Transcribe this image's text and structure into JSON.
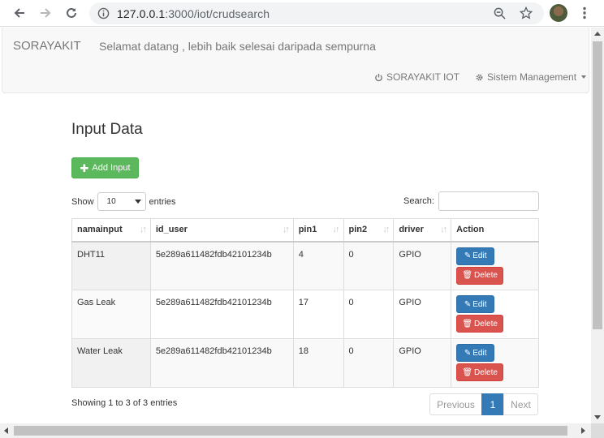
{
  "browser": {
    "url_host": "127.0.0.1",
    "url_path": ":3000/iot/crudsearch"
  },
  "navbar": {
    "brand": "SORAYAKIT",
    "welcome": "Selamat datang , lebih baik selesai daripada sempurna",
    "link_iot": "SORAYAKIT IOT",
    "link_system": "Sistem Management"
  },
  "page": {
    "title": "Input Data",
    "add_button": "Add Input"
  },
  "table_controls": {
    "show_label": "Show",
    "entries_label": "entries",
    "page_size": "10",
    "search_label": "Search:"
  },
  "table": {
    "headers": [
      "namainput",
      "id_user",
      "pin1",
      "pin2",
      "driver",
      "Action"
    ],
    "rows": [
      {
        "namainput": "DHT11",
        "id_user": "5e289a611482fdb42101234b",
        "pin1": "4",
        "pin2": "0",
        "driver": "GPIO"
      },
      {
        "namainput": "Gas Leak",
        "id_user": "5e289a611482fdb42101234b",
        "pin1": "17",
        "pin2": "0",
        "driver": "GPIO"
      },
      {
        "namainput": "Water Leak",
        "id_user": "5e289a611482fdb42101234b",
        "pin1": "18",
        "pin2": "0",
        "driver": "GPIO"
      }
    ],
    "edit_label": "Edit",
    "delete_label": "Delete"
  },
  "footer": {
    "info": "Showing 1 to 3 of 3 entries",
    "previous": "Previous",
    "current_page": "1",
    "next": "Next"
  },
  "colors": {
    "success": "#5cb85c",
    "primary": "#337ab7",
    "danger": "#d9534f"
  }
}
